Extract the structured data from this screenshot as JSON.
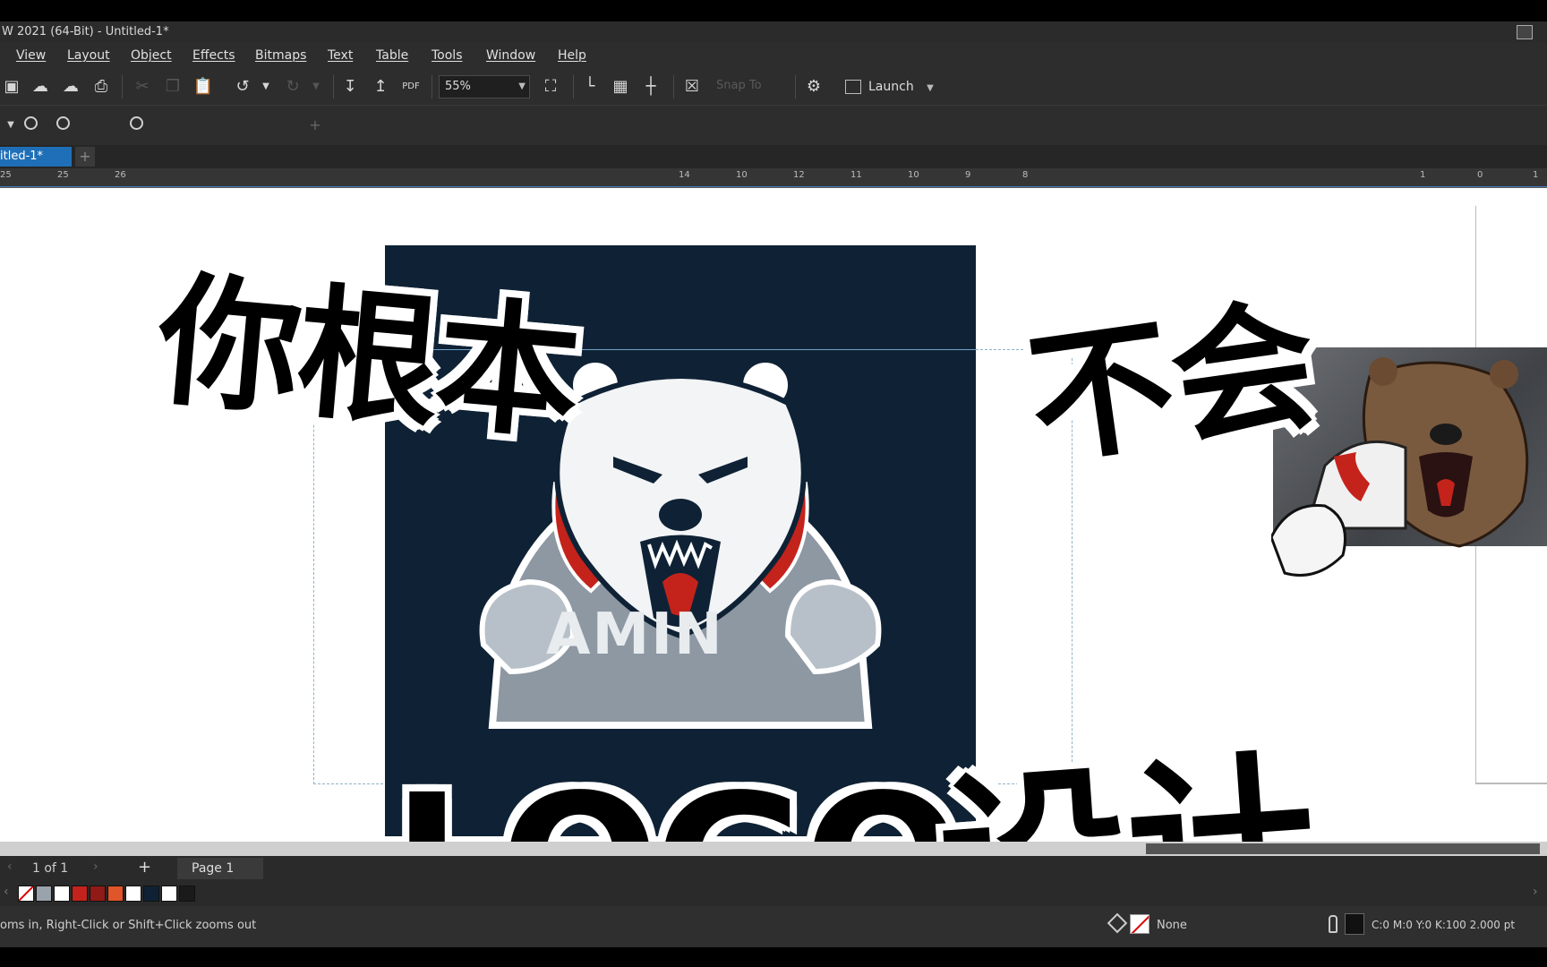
{
  "window": {
    "title": "W 2021 (64-Bit) - Untitled-1*"
  },
  "menu": {
    "items": [
      "View",
      "Layout",
      "Object",
      "Effects",
      "Bitmaps",
      "Text",
      "Table",
      "Tools",
      "Window",
      "Help"
    ]
  },
  "toolbar": {
    "zoom_value": "55%",
    "snap_label": "Snap To",
    "launch_label": "Launch"
  },
  "document": {
    "tab_label": "itled-1*"
  },
  "ruler": {
    "ticks": [
      "25",
      "25",
      "26",
      "14",
      "10",
      "12",
      "11",
      "10",
      "9",
      "8",
      "1",
      "0",
      "1"
    ]
  },
  "overlay": {
    "line1": "你根本",
    "line2": "不会",
    "line3": "LOGO",
    "line4": "设计"
  },
  "artwork": {
    "logo_text": "AMIN",
    "artboard_color": "#0f2235",
    "accent_red": "#c4231c"
  },
  "pages": {
    "count_label": "1 of 1",
    "tab_label": "Page 1"
  },
  "palette": {
    "colors": [
      "#ffffff",
      "#9aa3ab",
      "#ffffff",
      "#c4231c",
      "#8f1a16",
      "#e0552a",
      "#ffffff",
      "#0f2235",
      "#ffffff",
      "#1a1a1a"
    ]
  },
  "status": {
    "hint": "oms in, Right-Click or Shift+Click zooms out",
    "fill_label": "None",
    "outline_label": "C:0 M:0 Y:0 K:100  2.000 pt"
  }
}
